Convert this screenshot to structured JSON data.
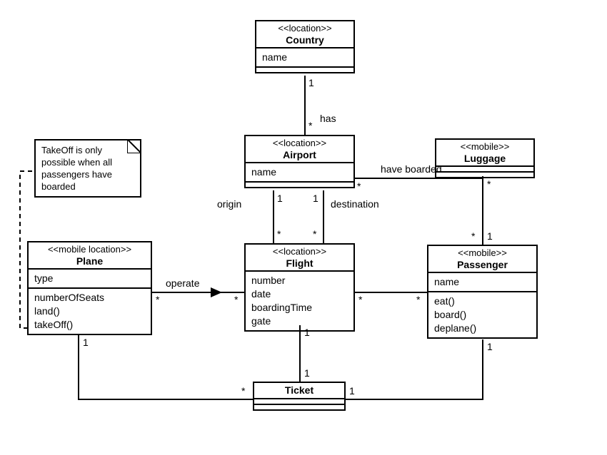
{
  "classes": {
    "country": {
      "stereo": "<<location>>",
      "name": "Country",
      "attrs": [
        "name"
      ]
    },
    "airport": {
      "stereo": "<<location>>",
      "name": "Airport",
      "attrs": [
        "name"
      ]
    },
    "flight": {
      "stereo": "<<location>>",
      "name": "Flight",
      "attrs": [
        "number",
        "date",
        "boardingTime",
        "gate"
      ]
    },
    "plane": {
      "stereo": "<<mobile location>>",
      "name": "Plane",
      "attrs": [
        "type"
      ],
      "ops": [
        "numberOfSeats",
        "land()",
        "takeOff()"
      ]
    },
    "passenger": {
      "stereo": "<<mobile>>",
      "name": "Passenger",
      "attrs": [
        "name"
      ],
      "ops": [
        "eat()",
        "board()",
        "deplane()"
      ]
    },
    "luggage": {
      "stereo": "<<mobile>>",
      "name": "Luggage"
    },
    "ticket": {
      "name": "Ticket"
    }
  },
  "note": {
    "text": "TakeOff is only possible when all passengers have boarded"
  },
  "assoc": {
    "has": {
      "label": "has",
      "countryEnd": "1",
      "airportEnd": "*"
    },
    "origin": {
      "label": "origin",
      "near": "1",
      "far": "*"
    },
    "destination": {
      "label": "destination",
      "near": "1",
      "far": "*"
    },
    "haveBoarded": {
      "label": "have boarded",
      "airportEnd": "*",
      "passengerEnd": "*"
    },
    "operate": {
      "label": "operate",
      "planeEnd": "*",
      "flightEnd": "*"
    },
    "flightPassenger": {
      "flightEnd": "*",
      "passengerEnd": "*"
    },
    "passengerLuggage": {
      "passengerEnd": "1",
      "luggageEnd": "*"
    },
    "ticketPlane": {
      "planeEnd": "1",
      "ticketEnd": "*"
    },
    "ticketFlight": {
      "flightEnd": "1",
      "ticketEnd": "1"
    },
    "ticketPassenger": {
      "passengerEnd": "1",
      "ticketEnd": "1"
    }
  }
}
